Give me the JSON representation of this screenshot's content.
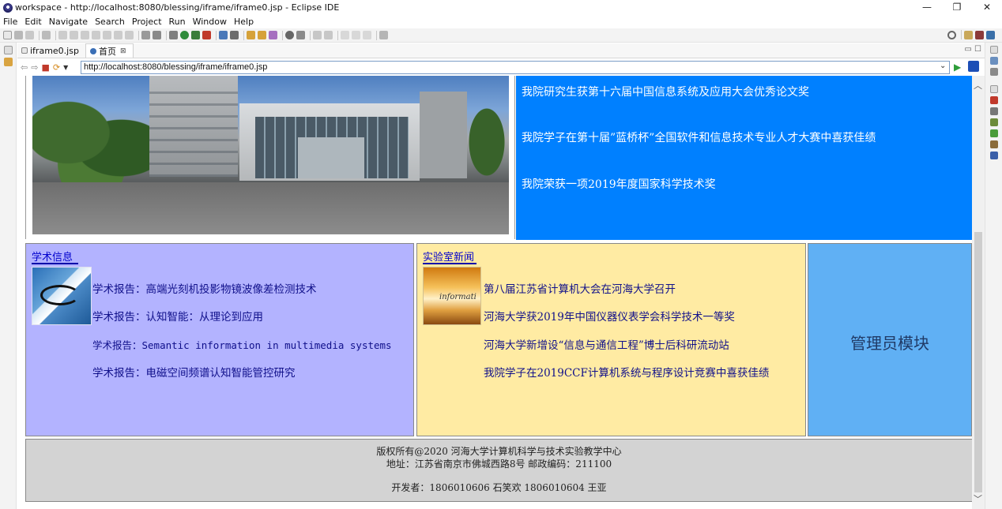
{
  "window": {
    "title": "workspace - http://localhost:8080/blessing/iframe/iframe0.jsp - Eclipse IDE",
    "controls": [
      "—",
      "❐",
      "✕"
    ]
  },
  "menu": [
    "File",
    "Edit",
    "Navigate",
    "Search",
    "Project",
    "Run",
    "Window",
    "Help"
  ],
  "editor_tabs": [
    {
      "label": "iframe0.jsp",
      "active": false
    },
    {
      "label": "首页",
      "active": true,
      "close": "⊠"
    }
  ],
  "browser": {
    "url": "http://localhost:8080/blessing/iframe/iframe0.jsp"
  },
  "top_news": [
    "我院研究生获第十六届中国信息系统及应用大会优秀论文奖",
    "我院学子在第十届”蓝桥杯”全国软件和信息技术专业人才大赛中喜获佳绩",
    "我院荣获一项2019年度国家科学技术奖"
  ],
  "academic": {
    "title": "学术信息",
    "items": [
      "学术报告：高端光刻机投影物镜波像差检测技术",
      "学术报告：认知智能：从理论到应用",
      "学术报告：Semantic information in multimedia systems",
      "学术报告：电磁空间频谱认知智能管控研究"
    ]
  },
  "lab_news": {
    "title": "实验室新闻",
    "thumb_word": "informati",
    "items": [
      "第八届江苏省计算机大会在河海大学召开",
      "河海大学获2019年中国仪器仪表学会科学技术一等奖",
      "河海大学新增设“信息与通信工程”博士后科研流动站",
      "我院学子在2019CCF计算机系统与程序设计竞赛中喜获佳绩"
    ]
  },
  "admin": {
    "label": "管理员模块"
  },
  "footer": {
    "copyright": "版权所有@2020 河海大学计算机科学与技术实验教学中心",
    "address": "地址：江苏省南京市佛城西路8号 邮政编码：211100",
    "developers": "开发者：1806010606 石笑欢  1806010604 王亚"
  },
  "colors": {
    "news_bg": "#0080ff",
    "academic_bg": "#b3b3ff",
    "lab_bg": "#ffeba3",
    "admin_bg": "#60b0f4",
    "footer_bg": "#d3d3d3",
    "link": "#10108a"
  }
}
